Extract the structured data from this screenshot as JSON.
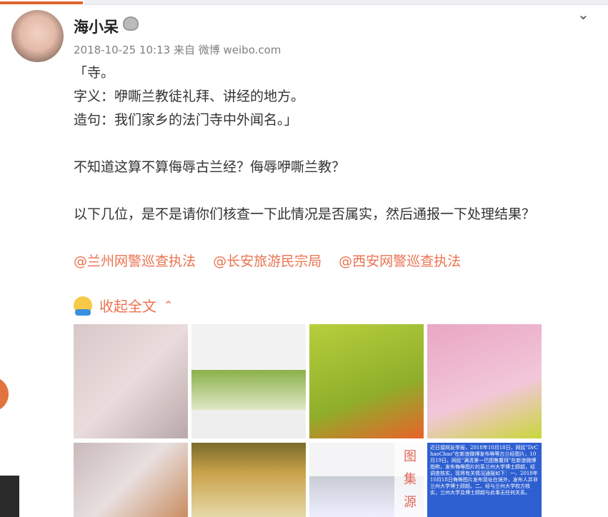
{
  "post": {
    "author": "海小呆",
    "timestamp": "2018-10-25 10:13",
    "source_prefix": "来自",
    "source": "微博 weibo.com",
    "lines": [
      "「寺。",
      "字义：咿嘶兰教徒礼拜、讲经的地方。",
      "造句：我们家乡的法门寺中外闻名。」",
      "",
      "不知道这算不算侮辱古兰经？侮辱咿嘶兰教？",
      "",
      "以下几位，是不是请你们核查一下此情况是否属实，然后通报一下处理结果？",
      ""
    ],
    "mentions": [
      "@兰州网警巡查执法",
      "@长安旅游民宗局",
      "@西安网警巡查执法"
    ],
    "collapse_label": "收起全文",
    "image_8_text": "近日接网友举报，2018年10月18日，网民\"DrChaoChao\"在新浪微博发布辱等古兰经图片，10月19日，网民\"满清第一巴图鲁鳌拜\"在新浪微博指称，发布侮辱图片的系兰州大学博士顾超，经调查核实，现将有关情况通报如下：一、2018年10月18日侮辱图片发布现址在境外，发布人并非兰州大学博士顾超。二、经与兰州大学校方核实，兰州大学及博士顾超与此事无任何关系。",
    "overlay_label": [
      "图",
      "集",
      "源"
    ]
  },
  "colors": {
    "accent": "#eb7350",
    "name": "#222222",
    "meta": "#808080"
  },
  "icons": {
    "verified": "crown-icon",
    "menu": "chevron-down-icon",
    "collapse": "chevron-up-icon"
  }
}
